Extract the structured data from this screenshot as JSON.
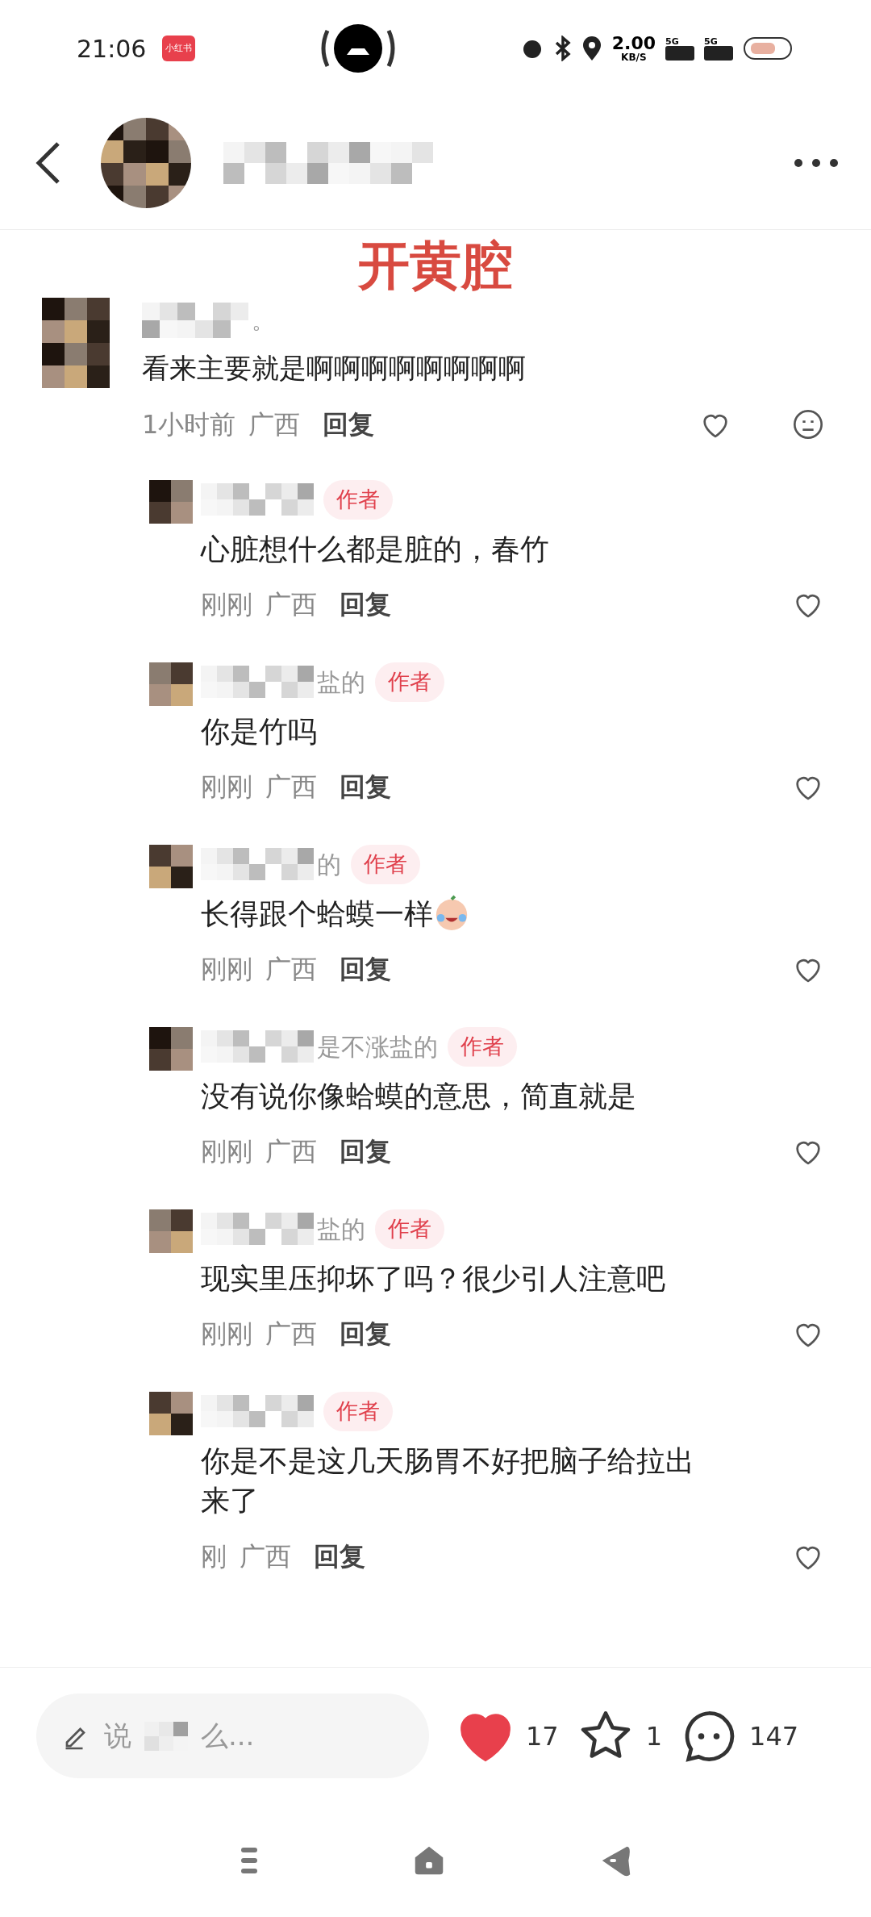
{
  "status_bar": {
    "time": "21:06",
    "app_badge": "小红书",
    "speed": "2.00",
    "speed_unit": "KB/S",
    "sims": [
      "5G",
      "5G"
    ]
  },
  "overlay_caption": "开黄腔",
  "comment": {
    "name_visible": "。",
    "text": "看来主要就是啊啊啊啊啊啊啊啊",
    "time": "1小时前",
    "location": "广西",
    "reply_label": "回复",
    "liked": false
  },
  "replies": [
    {
      "badge": "作者",
      "text": "心脏想什么都是脏的，春竹",
      "emoji": false,
      "time": "刚刚",
      "location": "广西",
      "reply_label": "回复",
      "liked": false
    },
    {
      "name_visible": "盐的",
      "badge": "作者",
      "text": "你是竹吗",
      "emoji": false,
      "time": "刚刚",
      "location": "广西",
      "reply_label": "回复",
      "liked": false
    },
    {
      "name_visible": "的",
      "badge": "作者",
      "text": "长得跟个蛤蟆一样",
      "emoji": true,
      "time": "刚刚",
      "location": "广西",
      "reply_label": "回复",
      "liked": false
    },
    {
      "name_visible": "是不涨盐的",
      "badge": "作者",
      "text": "没有说你像蛤蟆的意思，简直就是",
      "emoji": false,
      "time": "刚刚",
      "location": "广西",
      "reply_label": "回复",
      "liked": false
    },
    {
      "name_visible": "盐的",
      "badge": "作者",
      "text": "现实里压抑坏了吗？很少引人注意吧",
      "emoji": false,
      "time": "刚刚",
      "location": "广西",
      "reply_label": "回复",
      "liked": false
    },
    {
      "badge": "作者",
      "text": "你是不是这几天肠胃不好把脑子给拉出来了",
      "emoji": false,
      "time": "刚",
      "location": "广西",
      "reply_label": "回复",
      "liked": false
    }
  ],
  "composer": {
    "placeholder_start": "说",
    "placeholder_end": "么..."
  },
  "actions": [
    {
      "kind": "like",
      "count": "17",
      "active": true
    },
    {
      "kind": "collect",
      "count": "1",
      "active": false
    },
    {
      "kind": "comment",
      "count": "147"
    }
  ]
}
